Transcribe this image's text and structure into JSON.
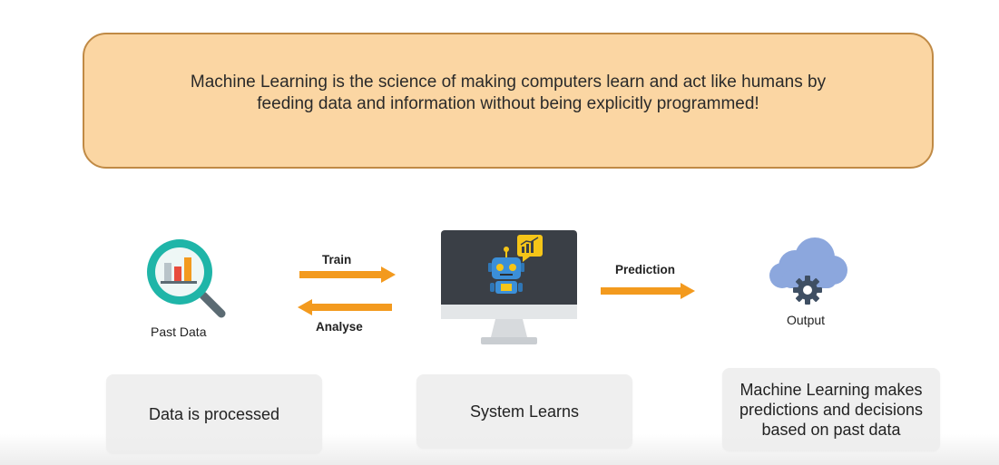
{
  "definition": {
    "line1": "Machine Learning is the science of making computers learn and act like humans by",
    "line2": "feeding data and information without being explicitly programmed!"
  },
  "flow": {
    "past_data": {
      "label": "Past Data",
      "icon": "magnifier-bar-chart-icon"
    },
    "train": {
      "label": "Train",
      "direction": "right"
    },
    "analyse": {
      "label": "Analyse",
      "direction": "left"
    },
    "system": {
      "icon": "monitor-robot-icon",
      "badge_icon": "chart-badge-icon"
    },
    "prediction": {
      "label": "Prediction",
      "direction": "right"
    },
    "output": {
      "label": "Output",
      "icon": "cloud-gear-icon"
    }
  },
  "cards": {
    "processed": "Data is processed",
    "learns": "System Learns",
    "predictions_line1": "Machine Learning makes",
    "predictions_line2": "predictions and decisions",
    "predictions_line3": "based on past data"
  },
  "colors": {
    "definition_bg": "#fbd6a3",
    "definition_border": "#c08a45",
    "arrow": "#f39a1e",
    "card_bg": "#efefef"
  }
}
